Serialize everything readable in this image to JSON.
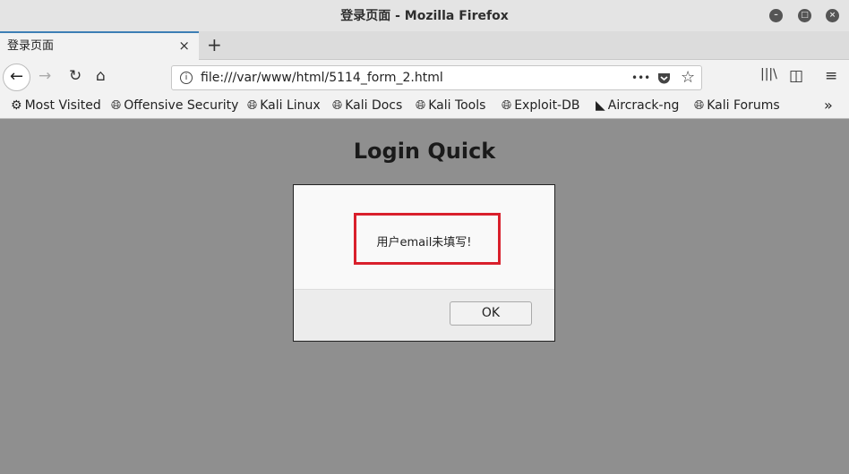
{
  "window": {
    "title": "登录页面 - Mozilla Firefox"
  },
  "tab": {
    "label": "登录页面",
    "close": "×",
    "new": "+"
  },
  "nav": {
    "url": "file:///var/www/html/5114_form_2.html",
    "more": "•••"
  },
  "bookmarks": [
    "Most Visited",
    "Offensive Security",
    "Kali Linux",
    "Kali Docs",
    "Kali Tools",
    "Exploit-DB",
    "Aircrack-ng",
    "Kali Forums"
  ],
  "page": {
    "heading": "Login Quick"
  },
  "dialog": {
    "message": "用户email未填写!",
    "ok_label": "OK",
    "highlight_color": "#d9202c"
  }
}
